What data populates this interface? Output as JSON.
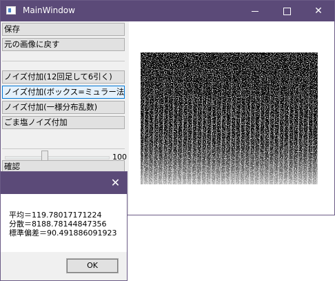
{
  "window": {
    "title": "MainWindow",
    "icons": {
      "app": "app-window-icon",
      "minimize": "minimize-icon",
      "maximize": "maximize-icon",
      "close": "close-icon"
    }
  },
  "buttons": {
    "save": "保存",
    "restore": "元の画像に戻す",
    "noise_sum12": "ノイズ付加(12回足して6引く)",
    "noise_box_muller": "ノイズ付加(ボックス=ミュラー法cos)",
    "noise_uniform": "ノイズ付加(一様分布乱数)",
    "salt_pepper": "ごま塩ノイズ付加",
    "confirm": "確認"
  },
  "slider": {
    "value": "100",
    "level": 0.38
  },
  "image": {
    "description_icon": "noise-image"
  },
  "dialog": {
    "mean": "平均＝119.78017171224",
    "variance": "分散＝8188.78144847356",
    "std": "標準偏差＝90.491886091923",
    "ok": "OK",
    "close_icon": "close-icon"
  },
  "colors": {
    "titlebar": "#5b4a78",
    "active_border": "#0078d7"
  }
}
